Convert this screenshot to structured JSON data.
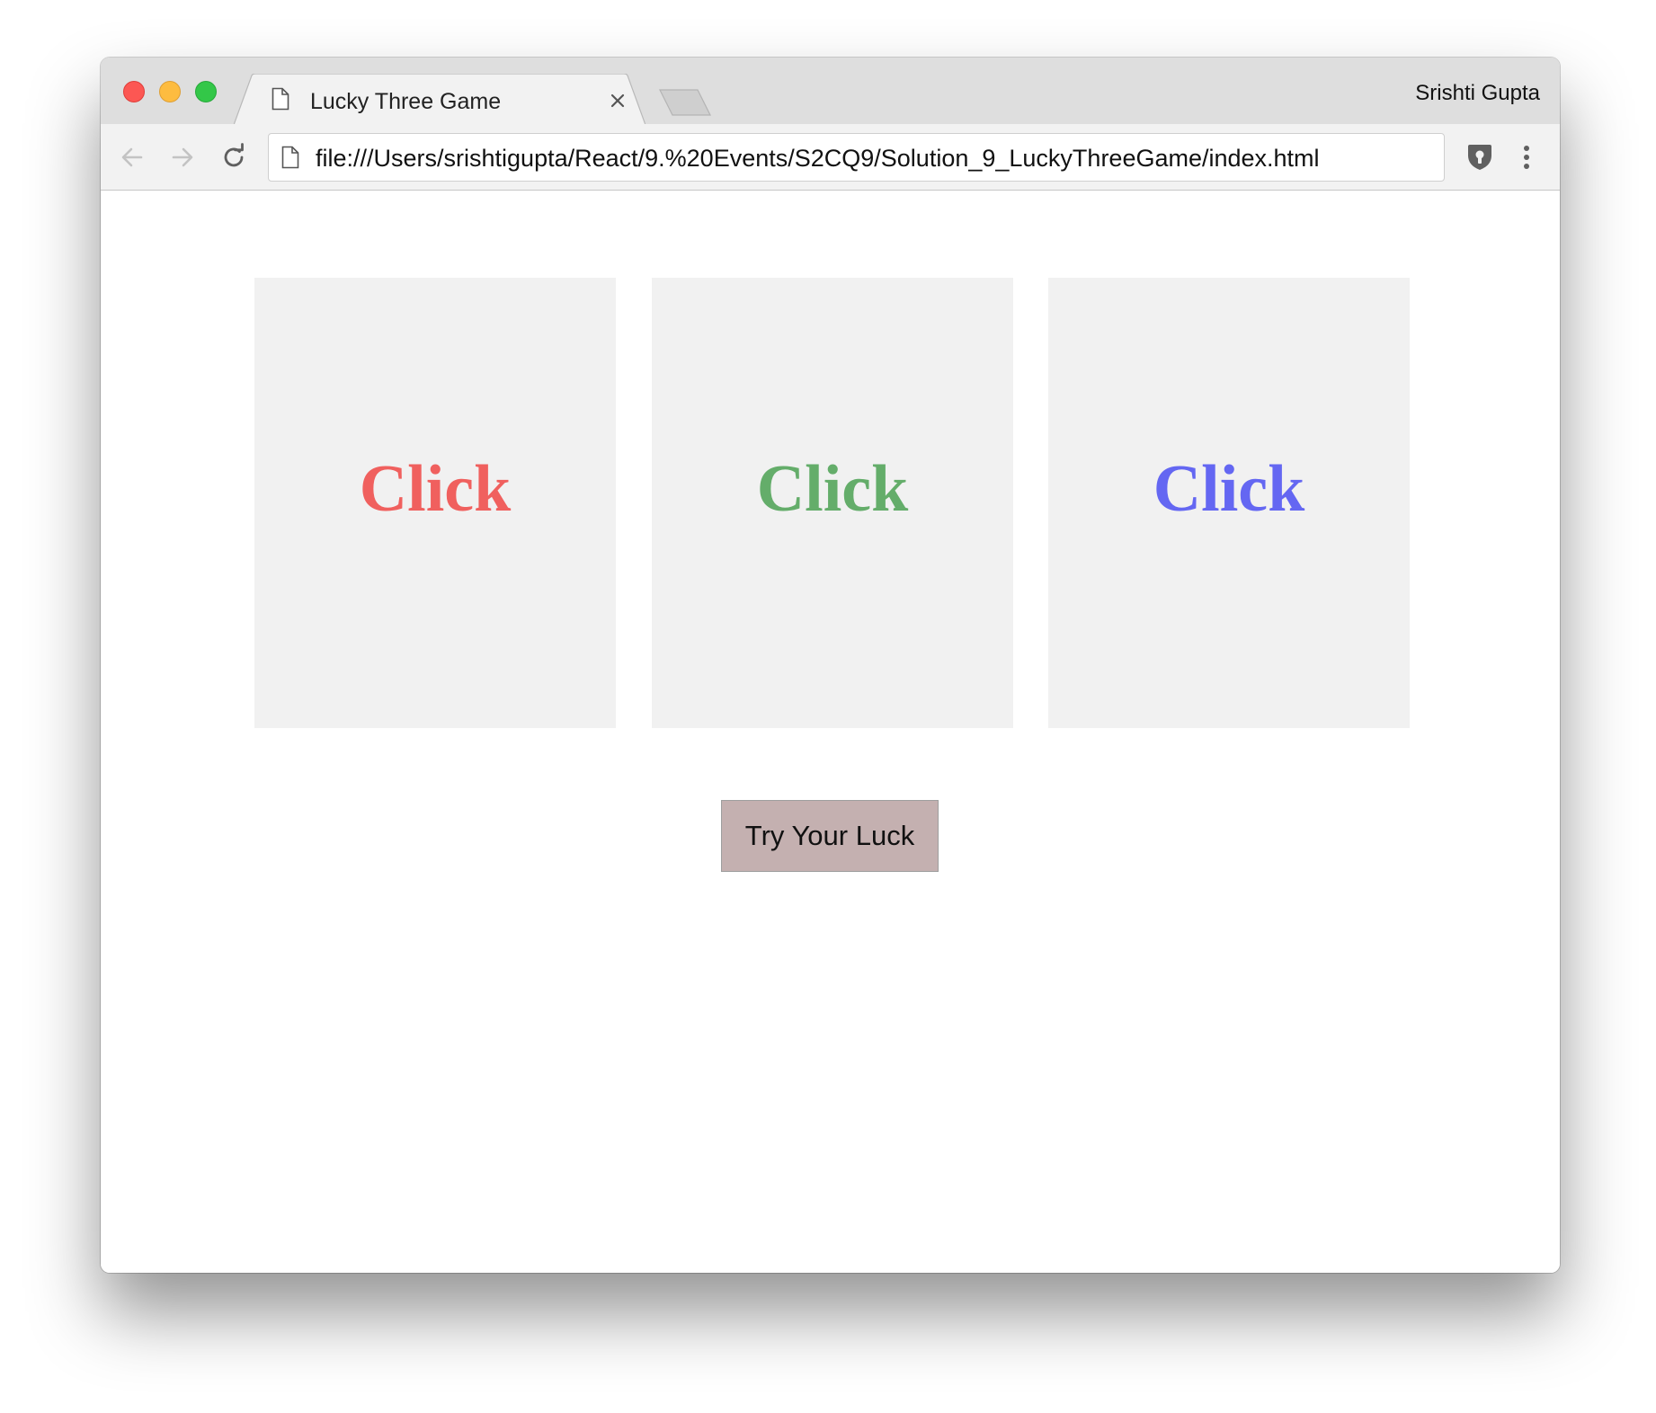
{
  "browser": {
    "tab_title": "Lucky Three Game",
    "profile_name": "Srishti Gupta",
    "url": "file:///Users/srishtigupta/React/9.%20Events/S2CQ9/Solution_9_LuckyThreeGame/index.html"
  },
  "game": {
    "cards": [
      {
        "label": "Click",
        "color": "#f0605e"
      },
      {
        "label": "Click",
        "color": "#64ad6a"
      },
      {
        "label": "Click",
        "color": "#6467f2"
      }
    ],
    "try_button_label": "Try Your Luck"
  },
  "icons": {
    "tab": "document-icon",
    "close": "close-icon",
    "back": "back-arrow-icon",
    "forward": "forward-arrow-icon",
    "reload": "reload-icon",
    "url": "document-icon",
    "extension": "shield-extension-icon",
    "menu": "kebab-menu-icon"
  },
  "colors": {
    "titlebar_bg": "#dedede",
    "toolbar_bg": "#f2f2f2",
    "card_bg": "#f1f1f1",
    "button_bg": "#c4b0b0"
  }
}
